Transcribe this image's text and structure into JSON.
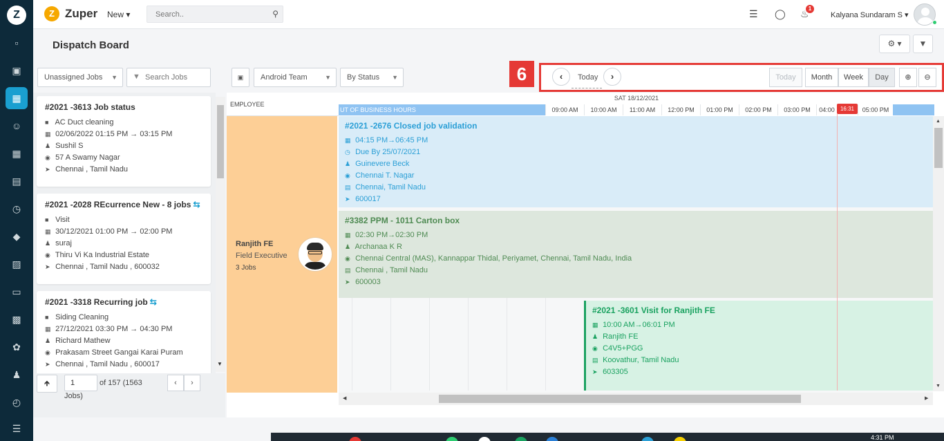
{
  "app": {
    "brand": "Zuper",
    "new_menu": "New",
    "search_placeholder": "Search..",
    "user_name": "Kalyana Sundaram S",
    "notification_count": "1"
  },
  "header": {
    "title": "Dispatch Board"
  },
  "filters": {
    "job_filter": "Unassigned Jobs",
    "search_placeholder": "Search Jobs",
    "team": "Android Team",
    "group_by": "By Status"
  },
  "annotation": {
    "number": "6"
  },
  "navigation": {
    "today_label": "Today",
    "today_button": "Today",
    "views": [
      "Month",
      "Week",
      "Day"
    ],
    "active_view": "Day"
  },
  "job_list": [
    {
      "title": "#2021 -3613 Job status",
      "recurring": false,
      "category": "AC Duct cleaning",
      "schedule": "02/06/2022 01:15 PM → 03:15 PM",
      "assignee": "Sushil S",
      "address": "57 A Swamy Nagar",
      "location": "Chennai , Tamil Nadu"
    },
    {
      "title": "#2021 -2028 REcurrence New - 8 jobs",
      "recurring": true,
      "category": "Visit",
      "schedule": "30/12/2021 01:00 PM → 02:00 PM",
      "assignee": "suraj",
      "address": "Thiru Vi Ka Industrial Estate",
      "location": "Chennai , Tamil Nadu , 600032"
    },
    {
      "title": "#2021 -3318 Recurring job",
      "recurring": true,
      "category": "Siding Cleaning",
      "schedule": "27/12/2021 03:30 PM → 04:30 PM",
      "assignee": "Richard Mathew",
      "address": "Prakasam Street Gangai Karai Puram",
      "location": "Chennai , Tamil Nadu , 600017"
    }
  ],
  "pagination": {
    "page": "1",
    "of_text": "of 157 (1563",
    "jobs_text": "Jobs)"
  },
  "schedule": {
    "employee_header": "EMPLOYEE",
    "date": "SAT 18/12/2021",
    "out_of_hours": "UT OF BUSINESS HOURS",
    "hours": [
      "09:00 AM",
      "10:00 AM",
      "11:00 AM",
      "12:00 PM",
      "01:00 PM",
      "02:00 PM",
      "03:00 PM",
      "04:00",
      "05:00 PM"
    ],
    "now_time": "16:31",
    "employee": {
      "name": "Ranjith FE",
      "role": "Field Executive",
      "jobs": "3 Jobs"
    },
    "jobs": [
      {
        "title": "#2021 -2676 Closed job validation",
        "time": "04:15 PM→06:45 PM",
        "due": "Due By 25/07/2021",
        "assignee": "Guinevere Beck",
        "address": "Chennai T. Nagar",
        "location": "Chennai, Tamil Nadu",
        "zip": "600017",
        "color": "#2b9fd6"
      },
      {
        "title": "#3382 PPM - 1011 Carton box",
        "time": "02:30 PM→02:30 PM",
        "assignee": "Archanaa K R",
        "address": "Chennai Central (MAS), Kannappar Thidal, Periyamet, Chennai, Tamil Nadu, India",
        "location": "Chennai , Tamil Nadu",
        "zip": "600003",
        "color": "#4e8a52"
      },
      {
        "title": "#2021 -3601 Visit for Ranjith FE",
        "time": "10:00 AM→06:01 PM",
        "assignee": "Ranjith FE",
        "address": "C4V5+PGG",
        "location": "Koovathur, Tamil Nadu",
        "zip": "603305",
        "color": "#1aa260"
      }
    ]
  },
  "taskbar": {
    "time": "4:31 PM"
  }
}
